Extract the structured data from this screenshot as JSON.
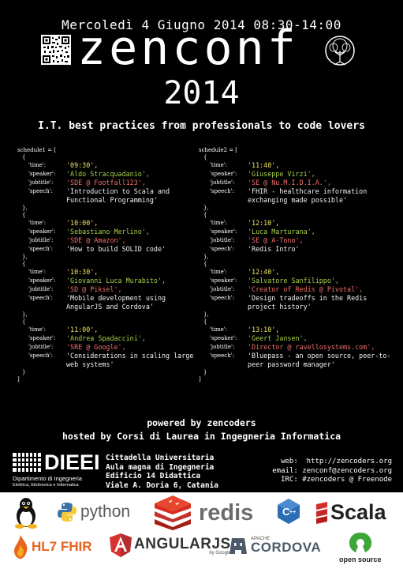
{
  "header": {
    "date": "Mercoledì 4 Giugno 2014 08:30-14:00",
    "logo": "zenconf",
    "year": "2014",
    "tagline": "I.T. best practices from professionals to code lovers"
  },
  "schedule1": {
    "open": "schedule1 = [",
    "entries": [
      {
        "time": "'09:30',",
        "speaker": "'Aldo Stracquadanio',",
        "jobtitle": "'SDE @ Footfall123',",
        "speech": "'Introduction to Scala and Functional Programming'"
      },
      {
        "time": "'10:00',",
        "speaker": "'Sebastiano Merlino',",
        "jobtitle": "'SDE @ Amazon',",
        "speech": "'How to build SOLID code'"
      },
      {
        "time": "'10:30',",
        "speaker": "'Giovanni Luca Murabito',",
        "jobtitle": "'SD @ Piksel',",
        "speech": "'Mobile development using AngularJS and Cordova'"
      },
      {
        "time": "'11:00',",
        "speaker": "'Andrea Spadaccini',",
        "jobtitle": "'SRE @ Google',",
        "speech": "'Considerations in scaling large web systems'"
      }
    ]
  },
  "schedule2": {
    "open": "schedule2 = [",
    "entries": [
      {
        "time": "'11:40',",
        "speaker": "'Giuseppe Virzi',",
        "jobtitle": "'SE @ Nu.M.I.D.I.A.',",
        "speech": "'FHIR - healthcare information exchanging made possible'"
      },
      {
        "time": "'12:10',",
        "speaker": "'Luca Marturana',",
        "jobtitle": "'SE @ A-Tono',",
        "speech": "'Redis  Intro'"
      },
      {
        "time": "'12:40',",
        "speaker": "'Salvatore Sanfilippo',",
        "jobtitle": "'Creator of Redis @ Pivotal',",
        "speech": "'Design tradeoffs in the Redis project history'"
      },
      {
        "time": "'13:10',",
        "speaker": "'Geert Jansen',",
        "jobtitle": "'Director @ ravellosystems.com',",
        "speech": "'Bluepass - an open source, peer-to-peer password manager'"
      }
    ]
  },
  "keys": {
    "time": "'time':",
    "speaker": "'speaker':",
    "jobtitle": "'jobtitle':",
    "speech": "'speech':"
  },
  "syntax": {
    "obj_open": "{",
    "obj_close": "},",
    "obj_close_last": "}",
    "list_close": "]"
  },
  "footer": {
    "powered": "powered by zencoders",
    "hosted": "hosted by Corsi di Laurea in Ingegneria Informatica",
    "dieei_name": "DIEEI",
    "dieei_sub1": "Dipartimento di Ingegneria",
    "dieei_sub2": "Elettrica, Elettronica e Informatica",
    "address": [
      "Cittadella Universitaria",
      "Aula magna di Ingegneria",
      "Edificio 14 Didattica",
      "Viale A. Doria 6, Catania"
    ],
    "web_label": "web:",
    "web": "http://zencoders.org",
    "email_label": "email:",
    "email": "zenconf@zencoders.org",
    "irc_label": "IRC:",
    "irc": "#zencoders @ Freenode"
  },
  "sponsors": {
    "python": "python",
    "redis": "redis",
    "scala": "Scala",
    "hl7": "HL7 FHIR",
    "angular": "ANGULARJS",
    "angular_by": "by Google",
    "cordova_top": "APACHE",
    "cordova": "CORDOVA",
    "opensource": "open source",
    "icons": [
      "linux-tux-icon",
      "python-icon",
      "redis-icon",
      "c-plus-plus-icon",
      "scala-icon",
      "hl7-flame-icon",
      "angular-shield-icon",
      "cordova-icon",
      "open-source-icon"
    ]
  },
  "colors": {
    "background": "#000000",
    "time": "#f0e060",
    "speaker": "#a9d14a",
    "jobtitle": "#f0706c",
    "speech": "#f2f2f2"
  }
}
